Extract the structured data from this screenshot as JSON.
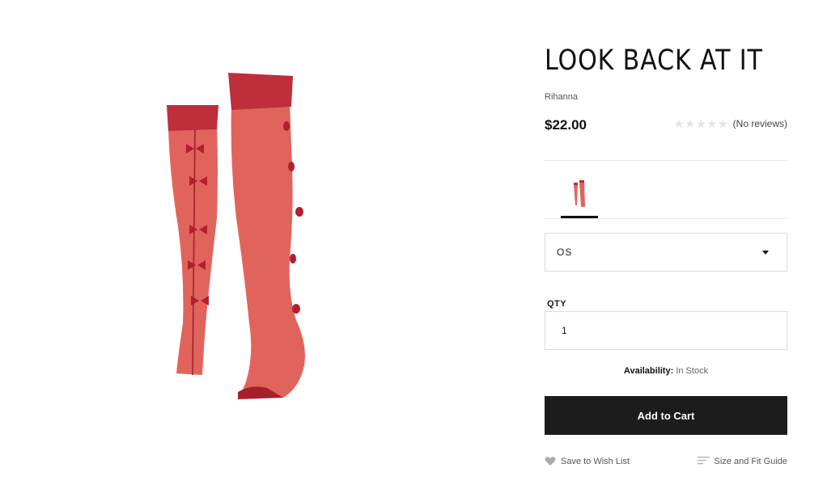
{
  "product": {
    "title": "LOOK BACK AT IT",
    "brand": "Rihanna",
    "price": "$22.00",
    "rating": {
      "stars": 5,
      "filled": 0,
      "reviews_label": "(No reviews)"
    }
  },
  "options": {
    "size_value": "OS",
    "qty_label": "QTY",
    "qty_value": "1"
  },
  "availability": {
    "label": "Availability:",
    "value": "In Stock"
  },
  "actions": {
    "add_to_cart": "Add to Cart",
    "wishlist": "Save to Wish List",
    "size_guide": "Size and Fit Guide"
  },
  "colors": {
    "stocking": "#e0645c",
    "stocking_band": "#bf2e3b",
    "bow": "#b21f2e",
    "button": "#1c1c1c"
  },
  "icons": {
    "wishlist": "heart-icon",
    "size_guide": "lines-icon",
    "select": "caret-down-icon",
    "star": "star-icon"
  }
}
